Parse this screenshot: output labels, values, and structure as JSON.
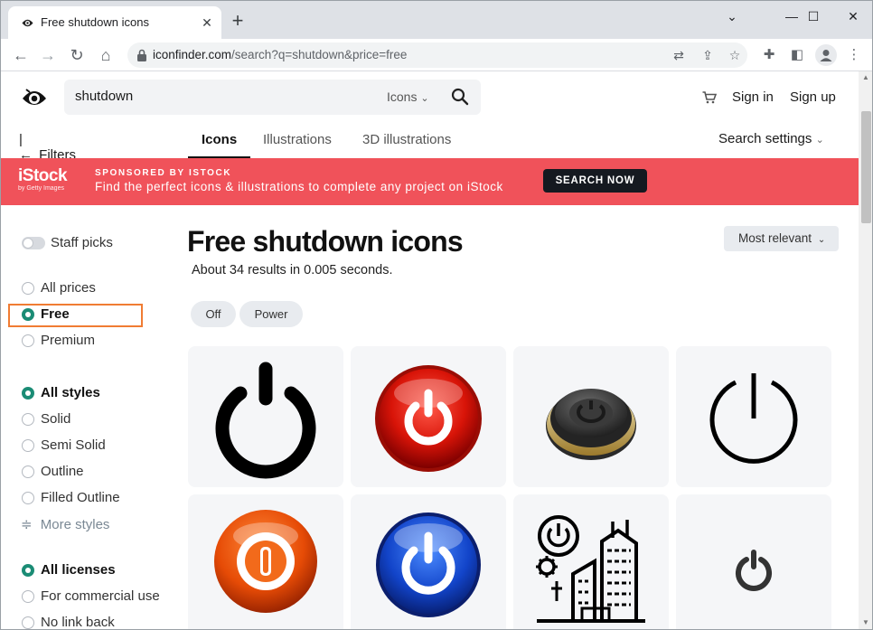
{
  "browser": {
    "tab_title": "Free shutdown icons",
    "url_host": "iconfinder.com",
    "url_path": "/search?q=shutdown&price=free"
  },
  "header": {
    "search_query": "shutdown",
    "search_type": "Icons",
    "sign_in": "Sign in",
    "sign_up": "Sign up"
  },
  "subnav": {
    "filters_label": "Filters",
    "tabs": [
      {
        "label": "Icons",
        "active": true
      },
      {
        "label": "Illustrations",
        "active": false
      },
      {
        "label": "3D illustrations",
        "active": false
      }
    ],
    "search_settings": "Search settings"
  },
  "banner": {
    "brand": "iStock",
    "brand_sub": "by Getty Images",
    "sponsor": "SPONSORED BY ISTOCK",
    "text": "Find the perfect icons & illustrations to complete any project on iStock",
    "cta": "SEARCH NOW",
    "color": "#f0525a"
  },
  "sidebar": {
    "staff_picks": "Staff picks",
    "prices": [
      {
        "label": "All prices",
        "selected": false
      },
      {
        "label": "Free",
        "selected": true
      },
      {
        "label": "Premium",
        "selected": false
      }
    ],
    "styles": [
      {
        "label": "All styles",
        "selected": true
      },
      {
        "label": "Solid",
        "selected": false
      },
      {
        "label": "Semi Solid",
        "selected": false
      },
      {
        "label": "Outline",
        "selected": false
      },
      {
        "label": "Filled Outline",
        "selected": false
      }
    ],
    "more_styles": "More styles",
    "licenses": [
      {
        "label": "All licenses",
        "selected": true
      },
      {
        "label": "For commercial use",
        "selected": false
      },
      {
        "label": "No link back",
        "selected": false
      }
    ],
    "accent_color": "#1b8c75"
  },
  "main": {
    "title": "Free shutdown icons",
    "results": "About 34 results in 0.005 seconds.",
    "sort": "Most relevant",
    "chips": [
      "Off",
      "Power"
    ],
    "icons": [
      "power-icon-black-thick",
      "power-icon-red-glossy",
      "power-icon-dark-3d-button",
      "power-icon-black-outline",
      "power-icon-orange-glossy",
      "power-icon-blue-glossy",
      "power-icon-city-building",
      "power-icon-small-dark"
    ]
  }
}
